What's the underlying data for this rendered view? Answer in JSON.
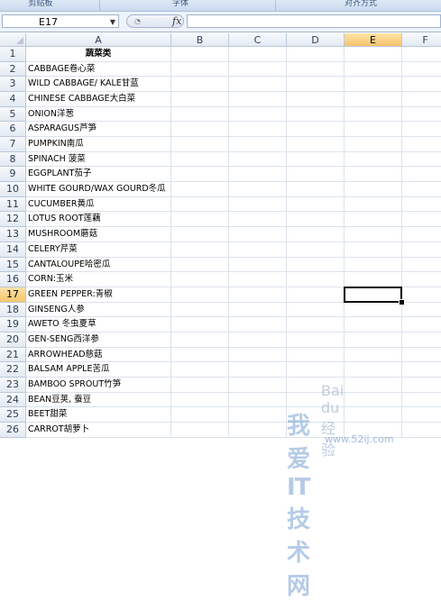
{
  "ribbon": {
    "groups": [
      "剪贴板",
      "字体",
      "对齐方式"
    ]
  },
  "formula_bar": {
    "name_box": "E17",
    "fx_label": "fx",
    "formula": ""
  },
  "columns": [
    "A",
    "B",
    "C",
    "D",
    "E",
    "F"
  ],
  "selected_column": "E",
  "selected_row": 17,
  "rows": [
    {
      "n": "1",
      "a": "蔬菜类",
      "header": true
    },
    {
      "n": "2",
      "a": "CABBAGE卷心菜"
    },
    {
      "n": "3",
      "a": "WILD CABBAGE/ KALE甘蓝"
    },
    {
      "n": "4",
      "a": "CHINESE CABBAGE大白菜"
    },
    {
      "n": "5",
      "a": "ONION洋葱"
    },
    {
      "n": "6",
      "a": "ASPARAGUS芦笋"
    },
    {
      "n": "7",
      "a": "PUMPKIN南瓜"
    },
    {
      "n": "8",
      "a": "SPINACH 菠菜"
    },
    {
      "n": "9",
      "a": "EGGPLANT茄子"
    },
    {
      "n": "10",
      "a": "WHITE GOURD/WAX GOURD冬瓜"
    },
    {
      "n": "11",
      "a": "CUCUMBER黄瓜"
    },
    {
      "n": "12",
      "a": "LOTUS ROOT莲藕"
    },
    {
      "n": "13",
      "a": "MUSHROOM蘑菇"
    },
    {
      "n": "14",
      "a": "CELERY芹菜"
    },
    {
      "n": "15",
      "a": "CANTALOUPE哈密瓜"
    },
    {
      "n": "16",
      "a": "CORN:玉米"
    },
    {
      "n": "17",
      "a": "GREEN PEPPER:青椒"
    },
    {
      "n": "18",
      "a": "GINSENG人参"
    },
    {
      "n": "19",
      "a": "AWETO 冬虫夏草"
    },
    {
      "n": "20",
      "a": "GEN-SENG西洋参"
    },
    {
      "n": "21",
      "a": "ARROWHEAD慈菇"
    },
    {
      "n": "22",
      "a": "BALSAM APPLE苦瓜"
    },
    {
      "n": "23",
      "a": "BAMBOO SPROUT竹笋"
    },
    {
      "n": "24",
      "a": "BEAN豆荚, 蚕豆"
    },
    {
      "n": "25",
      "a": "BEET甜菜"
    },
    {
      "n": "26",
      "a": "CARROT胡萝卜"
    }
  ],
  "watermark": {
    "text": "我爱IT技术网",
    "url": "www.52ij.com",
    "baidu": "Bai du 经验"
  },
  "colors": {
    "selection_header": "#f6c46c",
    "grid_line": "#dbe3ec",
    "header_bg": "#e3eaf3"
  }
}
